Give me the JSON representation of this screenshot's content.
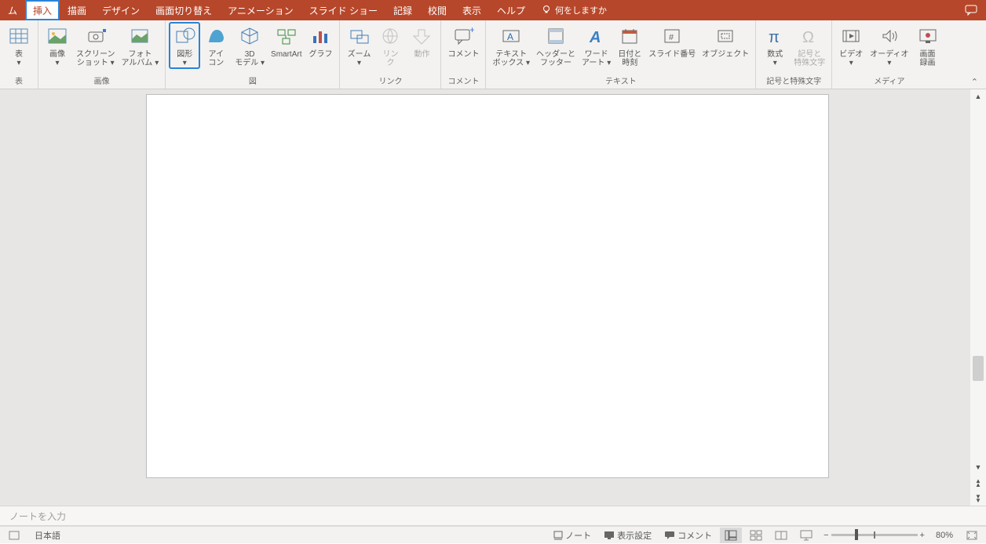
{
  "tabs": {
    "home_suffix": "ム",
    "insert": "挿入",
    "draw": "描画",
    "design": "デザイン",
    "transitions": "画面切り替え",
    "animations": "アニメーション",
    "slideshow": "スライド ショー",
    "record": "記録",
    "review": "校閲",
    "view": "表示",
    "help": "ヘルプ",
    "tellme": "何をしますか"
  },
  "ribbon": {
    "table": "表",
    "pictures": "画像",
    "screenshot": "スクリーン\nショット",
    "photoalbum": "フォト\nアルバム",
    "shapes": "図形",
    "icons": "アイ\nコン",
    "models3d": "3D\nモデル",
    "smartart": "SmartArt",
    "chart": "グラフ",
    "zoom": "ズーム",
    "link": "リン\nク",
    "action": "動作",
    "comment": "コメント",
    "textbox": "テキスト\nボックス",
    "headerfooter": "ヘッダーと\nフッター",
    "wordart": "ワード\nアート",
    "datetime": "日付と\n時刻",
    "slidenumber": "スライド番号",
    "object": "オブジェクト",
    "equation": "数式",
    "symbol": "記号と\n特殊文字",
    "video": "ビデオ",
    "audio": "オーディオ",
    "screenrec": "画面\n録画"
  },
  "groups": {
    "tables": "表",
    "images": "画像",
    "illustrations": "図",
    "links": "リンク",
    "comments": "コメント",
    "text": "テキスト",
    "symbols": "記号と特殊文字",
    "media": "メディア"
  },
  "notes": {
    "placeholder": "ノートを入力"
  },
  "status": {
    "language": "日本語",
    "notes": "ノート",
    "display": "表示設定",
    "comments": "コメント",
    "zoom": "80%",
    "minus": "−",
    "plus": "+"
  }
}
